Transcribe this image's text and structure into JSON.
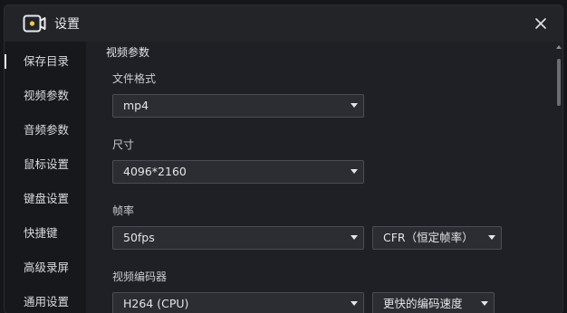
{
  "window": {
    "title": "设置"
  },
  "sidebar": {
    "items": [
      {
        "label": "保存目录",
        "active": true
      },
      {
        "label": "视频参数",
        "active": false
      },
      {
        "label": "音频参数",
        "active": false
      },
      {
        "label": "鼠标设置",
        "active": false
      },
      {
        "label": "键盘设置",
        "active": false
      },
      {
        "label": "快捷键",
        "active": false
      },
      {
        "label": "高级录屏",
        "active": false
      },
      {
        "label": "通用设置",
        "active": false
      }
    ]
  },
  "main": {
    "section_title": "视频参数",
    "file_format": {
      "label": "文件格式",
      "value": "mp4"
    },
    "size": {
      "label": "尺寸",
      "value": "4096*2160"
    },
    "frame_rate": {
      "label": "帧率",
      "value": "50fps",
      "mode_value": "CFR（恒定帧率）"
    },
    "encoder": {
      "label": "视频编码器",
      "value": "H264 (CPU)",
      "speed_value": "更快的编码速度"
    }
  },
  "colors": {
    "background": "#1e2025",
    "sidebar": "#17181b",
    "input": "#2b2d32",
    "accent_icon": "#f2c94c"
  }
}
